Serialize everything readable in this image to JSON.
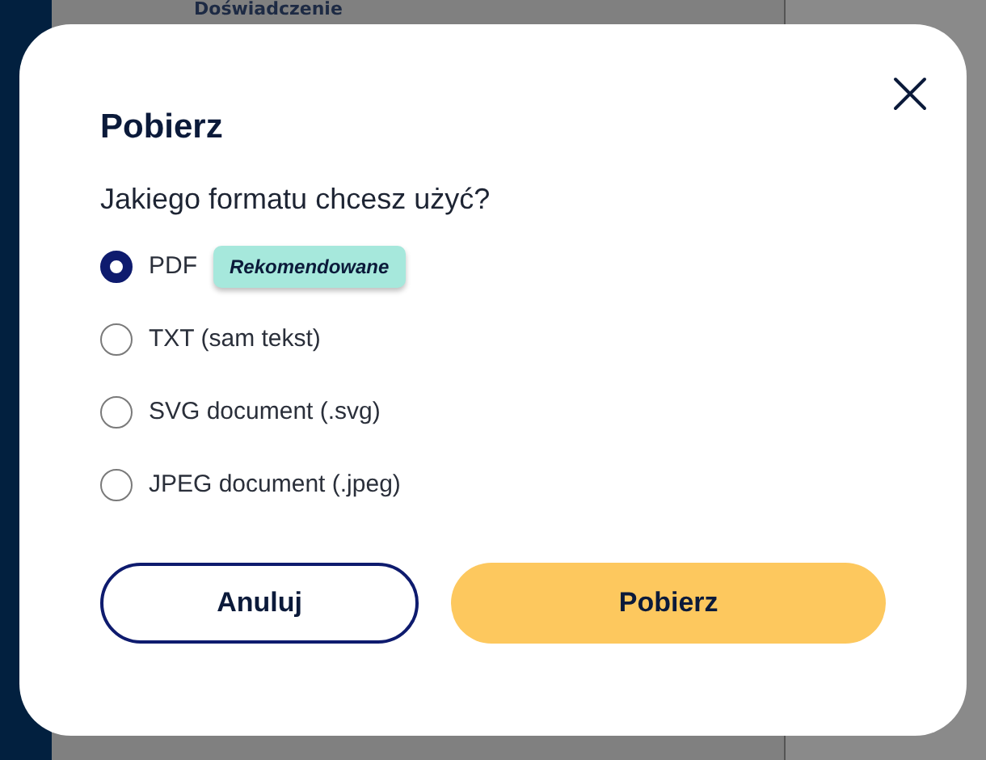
{
  "background": {
    "heading": "Doświadczenie"
  },
  "dialog": {
    "title": "Pobierz",
    "question": "Jakiego formatu chcesz użyć?",
    "options": [
      {
        "label": "PDF",
        "selected": true,
        "badge": "Rekomendowane"
      },
      {
        "label": "TXT (sam tekst)",
        "selected": false
      },
      {
        "label": "SVG document (.svg)",
        "selected": false
      },
      {
        "label": "JPEG document (.jpeg)",
        "selected": false
      }
    ],
    "buttons": [
      {
        "label": "Anuluj",
        "kind": "secondary"
      },
      {
        "label": "Pobierz",
        "kind": "primary"
      }
    ]
  }
}
